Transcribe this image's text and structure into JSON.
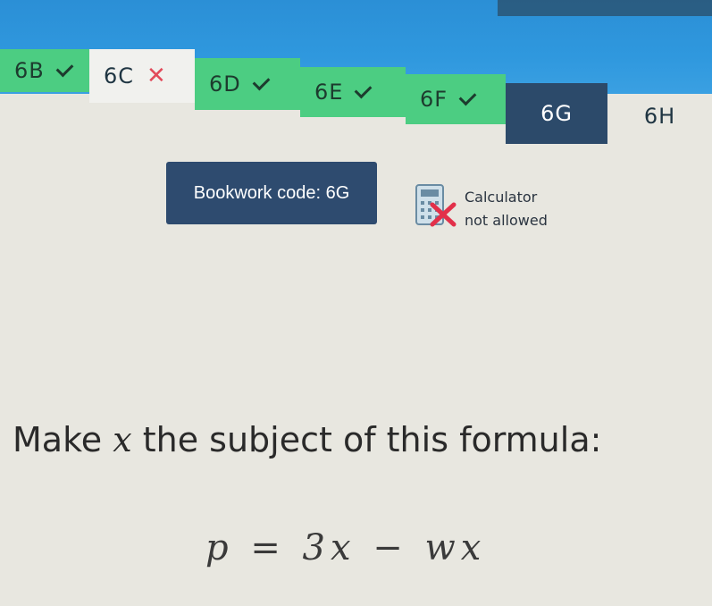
{
  "tabs": [
    {
      "label": "6B",
      "status": "correct"
    },
    {
      "label": "6C",
      "status": "incorrect"
    },
    {
      "label": "6D",
      "status": "correct"
    },
    {
      "label": "6E",
      "status": "correct"
    },
    {
      "label": "6F",
      "status": "correct"
    },
    {
      "label": "6G",
      "status": "current"
    },
    {
      "label": "6H",
      "status": "upcoming"
    }
  ],
  "bookwork": {
    "label": "Bookwork code: 6G"
  },
  "calculator": {
    "line1": "Calculator",
    "line2": "not allowed",
    "icon": "calculator-crossed-icon"
  },
  "question": {
    "prefix": "Make ",
    "variable": "x",
    "suffix": " the subject of this formula:",
    "formula": "p = 3x − wx"
  },
  "colors": {
    "top_bar": "#2f98de",
    "tab_done": "#4ccd82",
    "tab_active": "#2c4a6a",
    "cross": "#e24a5a"
  }
}
